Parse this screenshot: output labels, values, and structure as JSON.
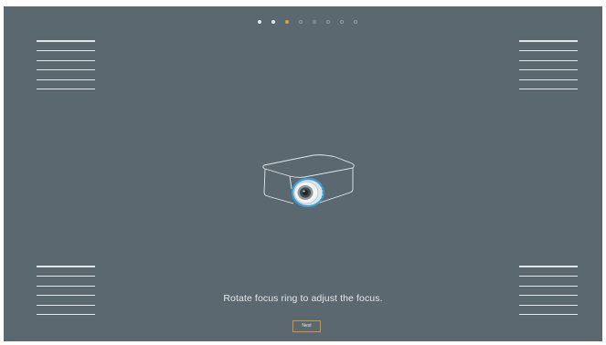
{
  "pagination": {
    "count": 8,
    "active_index": 2,
    "completed": 2
  },
  "illustration": {
    "icon": "projector-icon",
    "focus_ring_color": "#39a0d8"
  },
  "instruction": {
    "text": "Rotate focus ring to adjust the focus."
  },
  "next_button": {
    "label": "Next",
    "border_color": "#c99a3d"
  },
  "colors": {
    "background": "#5b6870",
    "lines": "#e3e7ea",
    "active_dot": "#d9a53b"
  }
}
